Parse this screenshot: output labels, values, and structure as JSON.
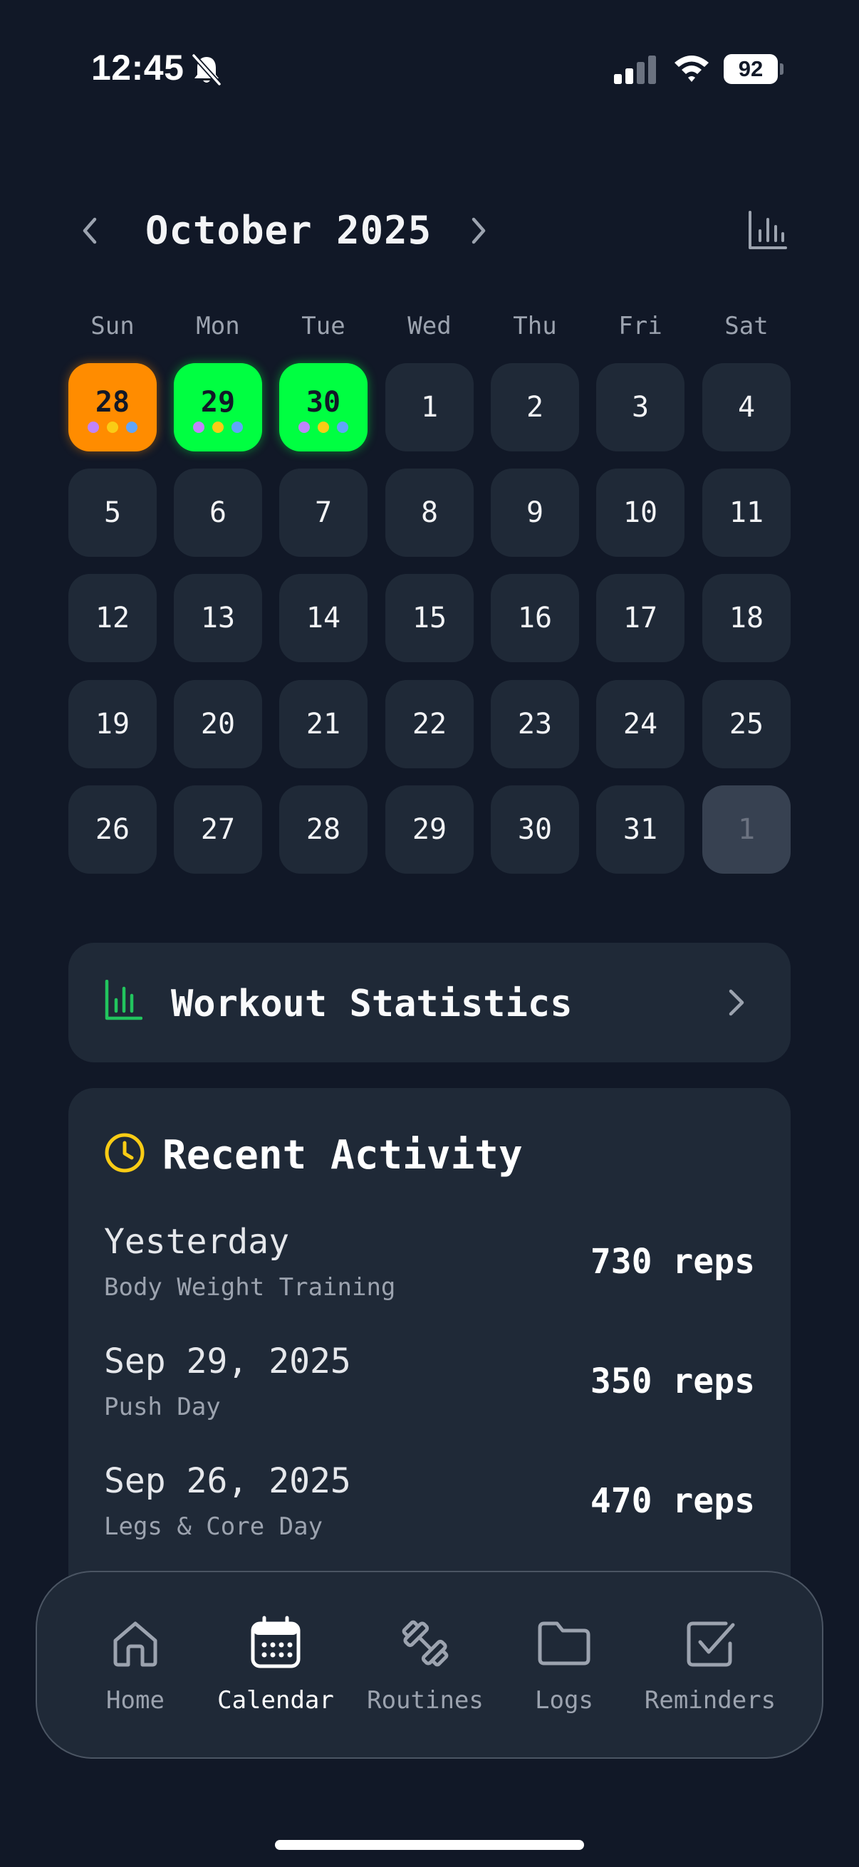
{
  "status_bar": {
    "time": "12:45",
    "battery": "92"
  },
  "header": {
    "month_title": "October 2025"
  },
  "weekdays": [
    "Sun",
    "Mon",
    "Tue",
    "Wed",
    "Thu",
    "Fri",
    "Sat"
  ],
  "calendar": {
    "weeks": [
      [
        "28",
        "29",
        "30",
        "1",
        "2",
        "3",
        "4"
      ],
      [
        "5",
        "6",
        "7",
        "8",
        "9",
        "10",
        "11"
      ],
      [
        "12",
        "13",
        "14",
        "15",
        "16",
        "17",
        "18"
      ],
      [
        "19",
        "20",
        "21",
        "22",
        "23",
        "24",
        "25"
      ],
      [
        "26",
        "27",
        "28",
        "29",
        "30",
        "31",
        "1"
      ]
    ],
    "highlight_colors": {
      "orange": "#ff8c00",
      "green": "#00ff41"
    },
    "dot_colors": [
      "#c084fc",
      "#facc15",
      "#60a5fa"
    ]
  },
  "workout_statistics": {
    "label": "Workout Statistics"
  },
  "recent_activity": {
    "title": "Recent Activity",
    "items": [
      {
        "date": "Yesterday",
        "routine": "Body Weight Training",
        "reps": "730 reps"
      },
      {
        "date": "Sep 29, 2025",
        "routine": "Push Day",
        "reps": "350 reps"
      },
      {
        "date": "Sep 26, 2025",
        "routine": "Legs & Core Day",
        "reps": "470 reps"
      }
    ]
  },
  "bottom_nav": {
    "items": [
      {
        "label": "Home",
        "icon": "home-icon"
      },
      {
        "label": "Calendar",
        "icon": "calendar-icon",
        "active": true
      },
      {
        "label": "Routines",
        "icon": "dumbbell-icon"
      },
      {
        "label": "Logs",
        "icon": "folder-icon"
      },
      {
        "label": "Reminders",
        "icon": "checkbox-icon"
      }
    ]
  },
  "colors": {
    "background": "#111827",
    "card": "#1f2937",
    "accent_green": "#22c55e",
    "accent_yellow": "#facc15"
  }
}
